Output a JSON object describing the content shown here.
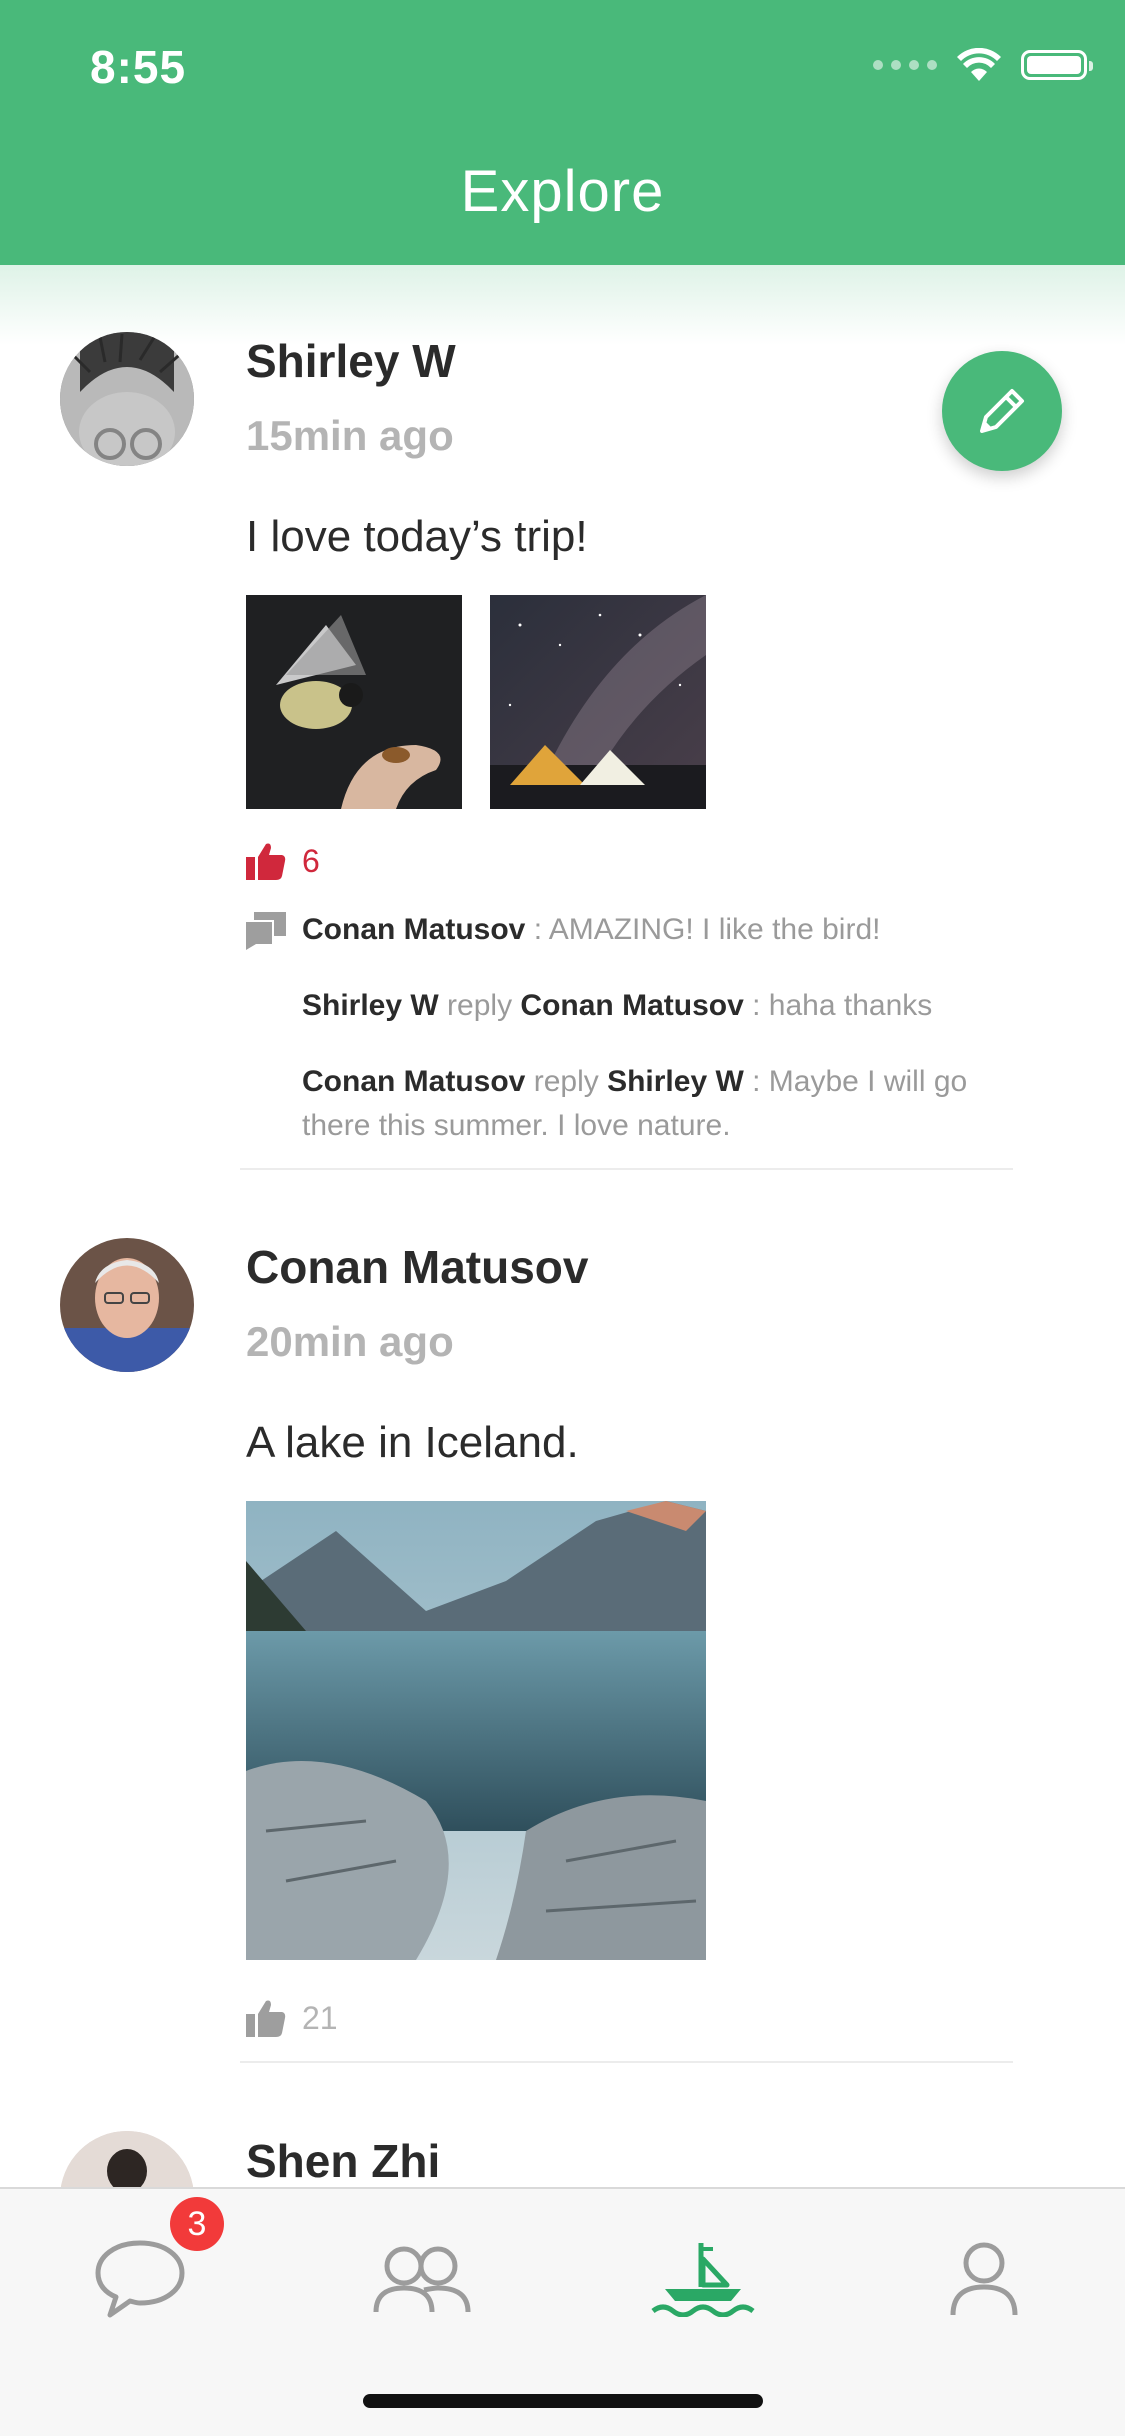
{
  "status_bar": {
    "time": "8:55"
  },
  "header": {
    "title": "Explore"
  },
  "colors": {
    "brand": "#49b97a",
    "like_active": "#d0283c",
    "muted": "#b4b4b4",
    "badge": "#f23a3a"
  },
  "compose": {
    "icon": "pencil-icon"
  },
  "posts": [
    {
      "author": "Shirley W",
      "time": "15min ago",
      "text": "I love today’s trip!",
      "photos": [
        "bird-on-hand-photo",
        "tents-under-milky-way-photo"
      ],
      "likes": "6",
      "liked": true,
      "comments": [
        {
          "from": "Conan Matusov",
          "text": ": AMAZING! I like the bird!"
        },
        {
          "from": "Shirley W",
          "reply_word": "reply",
          "to": "Conan Matusov",
          "text": ": haha thanks"
        },
        {
          "from": "Conan Matusov",
          "reply_word": "reply",
          "to": "Shirley W",
          "text": ": Maybe I will go there this summer. I love nature."
        }
      ]
    },
    {
      "author": "Conan Matusov",
      "time": "20min ago",
      "text": "A lake in Iceland.",
      "photos": [
        "mountain-lake-photo"
      ],
      "likes": "21",
      "liked": false
    },
    {
      "author": "Shen Zhi"
    }
  ],
  "tabbar": {
    "items": [
      {
        "icon": "chat-bubble-icon",
        "badge": "3"
      },
      {
        "icon": "contacts-icon"
      },
      {
        "icon": "boat-icon",
        "active": true
      },
      {
        "icon": "profile-icon"
      }
    ]
  }
}
